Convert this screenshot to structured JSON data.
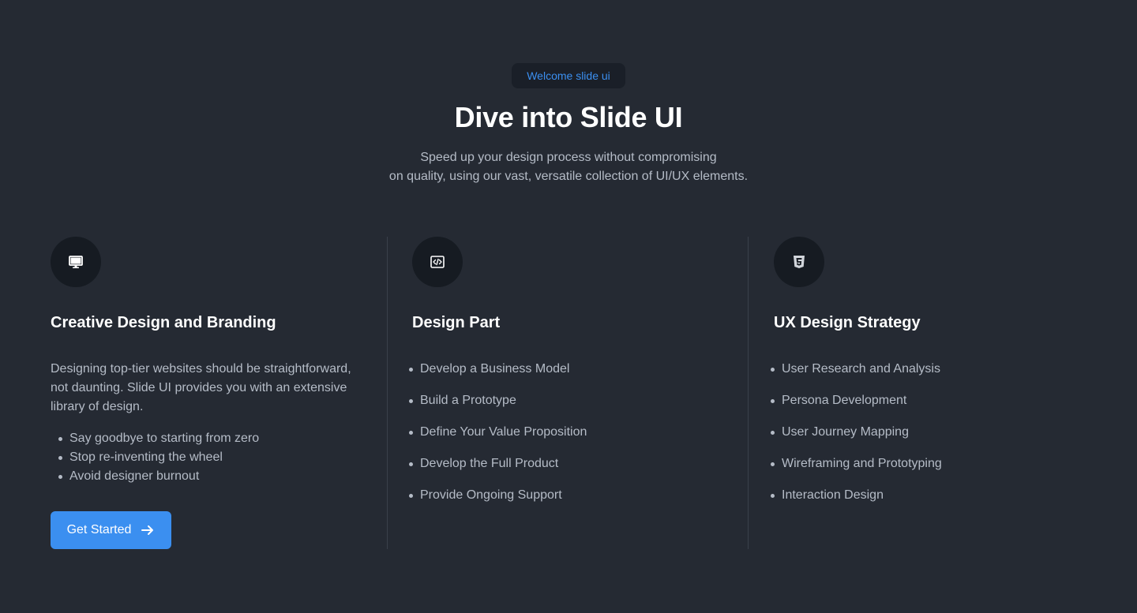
{
  "hero": {
    "badge": "Welcome slide ui",
    "title": "Dive into Slide UI",
    "subtitle_line1": "Speed up your design process without compromising",
    "subtitle_line2": "on quality, using our vast, versatile collection of UI/UX elements."
  },
  "columns": [
    {
      "icon": "monitor-icon",
      "title": "Creative Design and Branding",
      "description": "Designing top-tier websites should be straightforward, not daunting. Slide UI provides you with an extensive library of design.",
      "items": [
        "Say goodbye to starting from zero",
        "Stop re-inventing the wheel",
        "Avoid designer burnout"
      ],
      "cta": "Get Started"
    },
    {
      "icon": "code-icon",
      "title": "Design Part",
      "items": [
        "Develop a Business Model",
        "Build a Prototype",
        "Define Your Value Proposition",
        "Develop the Full Product",
        "Provide Ongoing Support"
      ]
    },
    {
      "icon": "html5-icon",
      "title": "UX Design Strategy",
      "items": [
        "User Research and Analysis",
        "Persona Development",
        "User Journey Mapping",
        "Wireframing and Prototyping",
        "Interaction Design"
      ]
    }
  ],
  "colors": {
    "background": "#252a33",
    "accent": "#3b8ff0",
    "icon_circle": "#161b22",
    "divider": "#3a404b"
  }
}
